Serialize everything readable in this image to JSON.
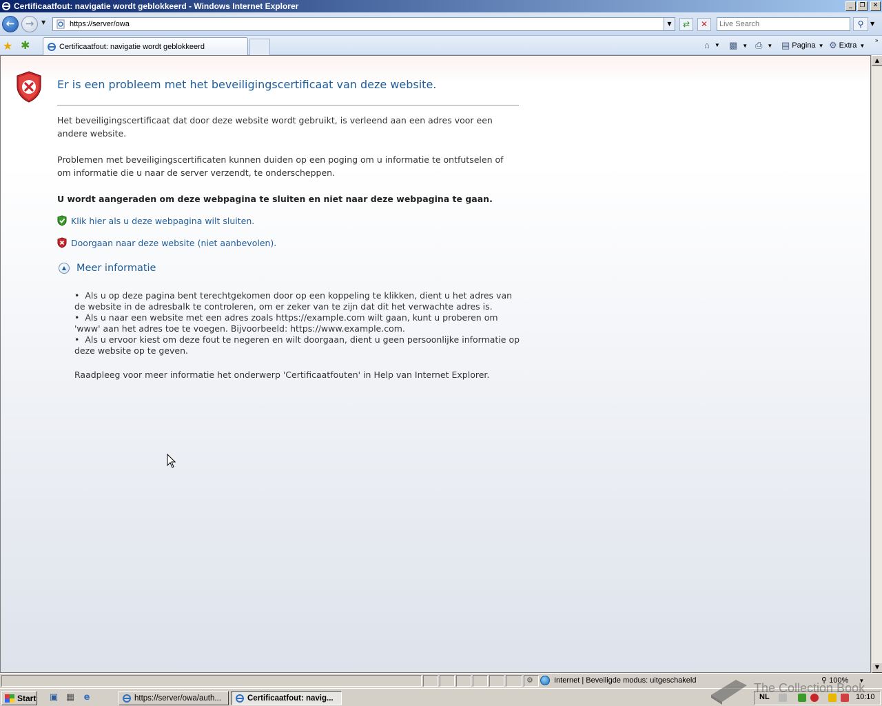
{
  "window": {
    "title": "Certificaatfout: navigatie wordt geblokkeerd - Windows Internet Explorer",
    "buttons": [
      "_",
      "❐",
      "✕"
    ]
  },
  "address_bar": {
    "url": "https://server/owa",
    "search_placeholder": "Live Search"
  },
  "tabs": [
    {
      "label": "Certificaatfout: navigatie wordt geblokkeerd"
    }
  ],
  "command_bar": {
    "page_label": "Pagina",
    "tools_label": "Extra"
  },
  "page": {
    "title": "Er is een probleem met het beveiligingscertificaat van deze website.",
    "paragraph_1": "Het beveiligingscertificaat dat door deze website wordt gebruikt, is verleend aan een adres voor een andere website.",
    "paragraph_2": "Problemen met beveiligingscertificaten kunnen duiden op een poging om u informatie te ontfutselen of om informatie die u naar de server verzendt, te onderscheppen.",
    "recommendation": "U wordt aangeraden om deze webpagina te sluiten en niet naar deze webpagina te gaan.",
    "close_link": "Klik hier als u deze webpagina wilt sluiten.",
    "continue_link": "Doorgaan naar deze website (niet aanbevolen).",
    "more_info_label": "Meer informatie",
    "bullets": [
      "Als u op deze pagina bent terechtgekomen door op een koppeling te klikken, dient u het adres van de website in de adresbalk te controleren, om er zeker van te zijn dat dit het verwachte adres is.",
      "Als u naar een website met een adres zoals https://example.com wilt gaan, kunt u proberen om 'www' aan het adres toe te voegen. Bijvoorbeeld: https://www.example.com.",
      "Als u ervoor kiest om deze fout te negeren en wilt doorgaan, dient u geen persoonlijke informatie op deze website op te geven."
    ],
    "help_note": "Raadpleeg voor meer informatie het onderwerp 'Certificaatfouten' in Help van Internet Explorer."
  },
  "status_bar": {
    "zone_text": "Internet | Beveiligde modus: uitgeschakeld",
    "zoom": "100%"
  },
  "taskbar": {
    "start_label": "Start",
    "task_1": "https://server/owa/auth...",
    "task_2": "Certificaatfout: navig...",
    "language": "NL",
    "clock": "10:10"
  },
  "watermark": "The Collection Book",
  "colors": {
    "title_blue": "#1f5d9b",
    "danger_red": "#c8262b",
    "safe_green": "#3a9a2a"
  }
}
